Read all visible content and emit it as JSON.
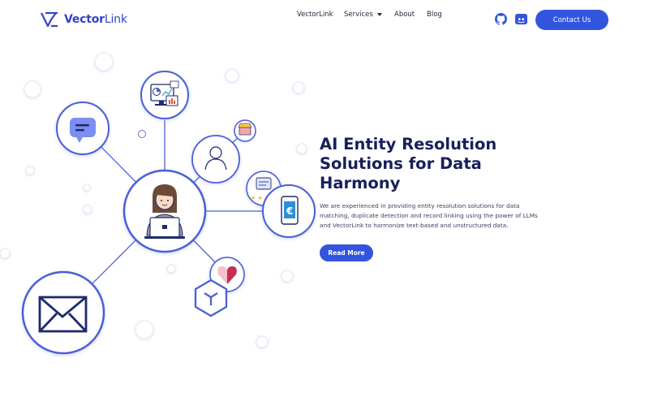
{
  "header": {
    "logo": {
      "text_main": "Vector",
      "text_light": "Link"
    },
    "nav": [
      {
        "label": "VectorLink"
      },
      {
        "label": "Services"
      },
      {
        "label": "About"
      },
      {
        "label": "Blog"
      }
    ],
    "social": {
      "github_icon": "github-icon",
      "discord_icon": "discord-icon"
    },
    "contact_button": "Contact Us"
  },
  "hero": {
    "title": "AI Entity Resolution Solutions for Data Harmony",
    "description": "We are experienced in providing entity resolution solutions for data matching, duplicate detection and record linking using the power of LLMs and VectorLink to harmonize text-based and unstructured data.",
    "read_more": "Read More"
  },
  "colors": {
    "brand": "#3355dd",
    "title": "#17205c",
    "icon_navy": "#1e2a6e"
  }
}
